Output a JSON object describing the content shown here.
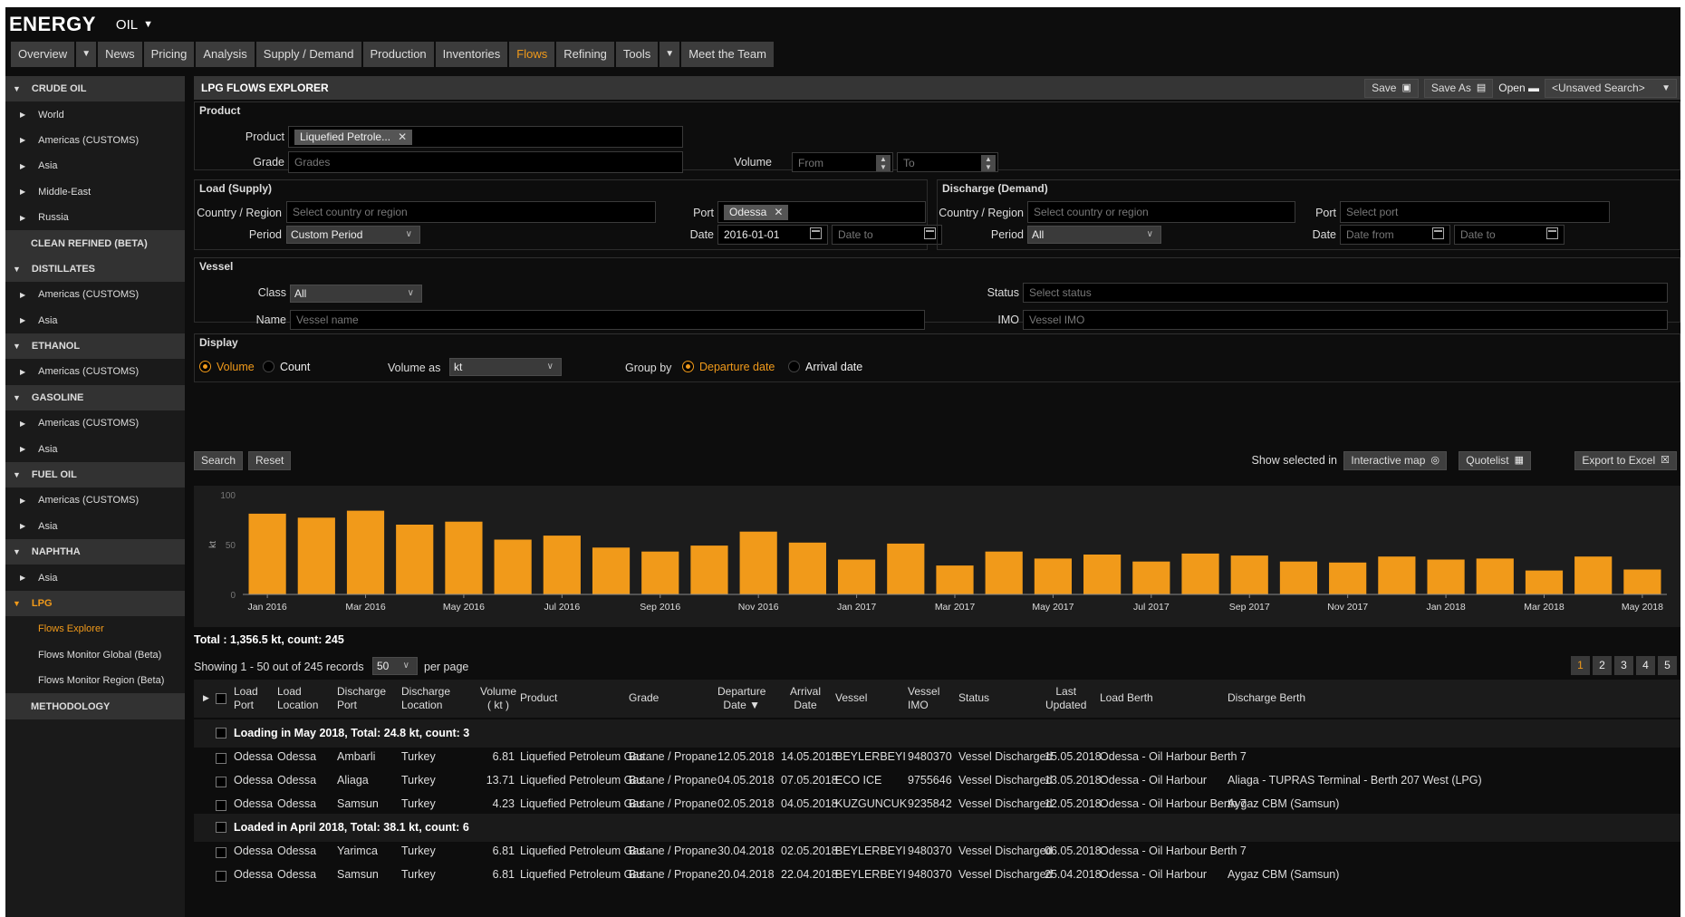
{
  "header": {
    "logo": "ENERGY",
    "commodity": "OIL"
  },
  "nav": {
    "tabs": [
      {
        "label": "Overview"
      },
      {
        "label": "▼",
        "drop": true
      },
      {
        "label": "News"
      },
      {
        "label": "Pricing"
      },
      {
        "label": "Analysis"
      },
      {
        "label": "Supply / Demand"
      },
      {
        "label": "Production"
      },
      {
        "label": "Inventories"
      },
      {
        "label": "Flows",
        "active": true
      },
      {
        "label": "Refining"
      },
      {
        "label": "Tools"
      },
      {
        "label": "▼",
        "drop": true
      },
      {
        "label": "Meet the Team"
      }
    ]
  },
  "sidebar": {
    "rows": [
      {
        "type": "section",
        "label": "CRUDE OIL"
      },
      {
        "type": "item",
        "label": "World"
      },
      {
        "type": "item",
        "label": "Americas (CUSTOMS)"
      },
      {
        "type": "item",
        "label": "Asia"
      },
      {
        "type": "item",
        "label": "Middle-East"
      },
      {
        "type": "item",
        "label": "Russia"
      },
      {
        "type": "section-noarr",
        "label": "CLEAN REFINED (BETA)"
      },
      {
        "type": "section",
        "label": "DISTILLATES"
      },
      {
        "type": "item",
        "label": "Americas (CUSTOMS)"
      },
      {
        "type": "item",
        "label": "Asia"
      },
      {
        "type": "section",
        "label": "ETHANOL"
      },
      {
        "type": "item",
        "label": "Americas (CUSTOMS)"
      },
      {
        "type": "section",
        "label": "GASOLINE"
      },
      {
        "type": "item",
        "label": "Americas (CUSTOMS)"
      },
      {
        "type": "item",
        "label": "Asia"
      },
      {
        "type": "section",
        "label": "FUEL OIL"
      },
      {
        "type": "item",
        "label": "Americas (CUSTOMS)"
      },
      {
        "type": "item",
        "label": "Asia"
      },
      {
        "type": "section",
        "label": "NAPHTHA"
      },
      {
        "type": "item",
        "label": "Asia"
      },
      {
        "type": "section-active",
        "label": "LPG"
      },
      {
        "type": "sub-active",
        "label": "Flows Explorer"
      },
      {
        "type": "sub",
        "label": "Flows Monitor Global (Beta)"
      },
      {
        "type": "sub",
        "label": "Flows Monitor Region (Beta)"
      },
      {
        "type": "section-noarr",
        "label": "METHODOLOGY"
      }
    ]
  },
  "panel": {
    "title": "LPG FLOWS EXPLORER",
    "save": "Save",
    "save_as": "Save As",
    "open": "Open",
    "search_select": "<Unsaved Search>"
  },
  "product": {
    "heading": "Product",
    "product_label": "Product",
    "product_tag": "Liquefied Petrole...",
    "grade_label": "Grade",
    "grade_placeholder": "Grades",
    "volume_label": "Volume",
    "volume_from": "From",
    "volume_to": "To"
  },
  "load": {
    "heading": "Load (Supply)",
    "country_label": "Country / Region",
    "country_placeholder": "Select country or region",
    "port_label": "Port",
    "port_tag": "Odessa",
    "period_label": "Period",
    "period_value": "Custom Period",
    "date_label": "Date",
    "date_from": "2016-01-01",
    "date_to": "Date to"
  },
  "discharge": {
    "heading": "Discharge (Demand)",
    "country_label": "Country / Region",
    "country_placeholder": "Select country or region",
    "port_label": "Port",
    "port_placeholder": "Select port",
    "period_label": "Period",
    "period_value": "All",
    "date_label": "Date",
    "date_from": "Date from",
    "date_to": "Date to"
  },
  "vessel": {
    "heading": "Vessel",
    "class_label": "Class",
    "class_value": "All",
    "name_label": "Name",
    "name_placeholder": "Vessel name",
    "status_label": "Status",
    "status_placeholder": "Select status",
    "imo_label": "IMO",
    "imo_placeholder": "Vessel IMO"
  },
  "display": {
    "heading": "Display",
    "volume": "Volume",
    "count": "Count",
    "volume_as_label": "Volume as",
    "volume_as_value": "kt",
    "group_by_label": "Group by",
    "departure": "Departure date",
    "arrival": "Arrival date"
  },
  "actions": {
    "search": "Search",
    "reset": "Reset",
    "show_selected": "Show selected in",
    "interactive_map": "Interactive map",
    "quotelist": "Quotelist",
    "export": "Export to Excel"
  },
  "chart_data": {
    "type": "bar",
    "ylabel": "kt",
    "ylim": [
      0,
      100
    ],
    "yticks": [
      0,
      50,
      100
    ],
    "color": "#f19a1a",
    "x_tick_labels": [
      "Jan 2016",
      "Mar 2016",
      "May 2016",
      "Jul 2016",
      "Sep 2016",
      "Nov 2016",
      "Jan 2017",
      "Mar 2017",
      "May 2017",
      "Jul 2017",
      "Sep 2017",
      "Nov 2017",
      "Jan 2018",
      "Mar 2018",
      "May 2018"
    ],
    "categories": [
      "Jan 2016",
      "Feb 2016",
      "Mar 2016",
      "Apr 2016",
      "May 2016",
      "Jun 2016",
      "Jul 2016",
      "Aug 2016",
      "Sep 2016",
      "Oct 2016",
      "Nov 2016",
      "Dec 2016",
      "Jan 2017",
      "Feb 2017",
      "Mar 2017",
      "Apr 2017",
      "May 2017",
      "Jun 2017",
      "Jul 2017",
      "Aug 2017",
      "Sep 2017",
      "Oct 2017",
      "Nov 2017",
      "Dec 2017",
      "Jan 2018",
      "Feb 2018",
      "Mar 2018",
      "Apr 2018",
      "May 2018"
    ],
    "values": [
      81,
      77,
      84,
      70,
      73,
      55,
      59,
      47,
      43,
      49,
      63,
      52,
      35,
      51,
      29,
      43,
      36,
      40,
      33,
      41,
      39,
      33,
      32,
      38,
      35,
      36,
      24,
      38,
      25
    ]
  },
  "summary": {
    "total": "Total : 1,356.5 kt, count: 245",
    "showing": "Showing 1 - 50 out of 245 records",
    "per_page_value": "50",
    "per_page": "per page",
    "pages": [
      "1",
      "2",
      "3",
      "4",
      "5"
    ]
  },
  "table": {
    "headers": {
      "load_port": "Load\nPort",
      "load_location": "Load\nLocation",
      "discharge_port": "Discharge\nPort",
      "discharge_location": "Discharge\nLocation",
      "volume": "Volume\n( kt )",
      "product": "Product",
      "grade": "Grade",
      "departure": "Departure\nDate ▼",
      "arrival": "Arrival\nDate",
      "vessel": "Vessel",
      "imo": "Vessel\nIMO",
      "status": "Status",
      "last_updated": "Last\nUpdated",
      "load_berth": "Load Berth",
      "discharge_berth": "Discharge Berth"
    },
    "rows": [
      {
        "group": "Loading in May 2018, Total: 24.8 kt, count: 3"
      },
      {
        "load_port": "Odessa",
        "load_location": "Odessa",
        "discharge_port": "Ambarli",
        "discharge_location": "Turkey",
        "volume": "6.81",
        "product": "Liquefied Petroleum Gas",
        "grade": "Butane / Propane",
        "departure": "12.05.2018",
        "arrival": "14.05.2018",
        "vessel": "BEYLERBEYI",
        "imo": "9480370",
        "status": "Vessel Discharged",
        "last_updated": "15.05.2018",
        "load_berth": "Odessa - Oil Harbour Berth 7",
        "discharge_berth": ""
      },
      {
        "load_port": "Odessa",
        "load_location": "Odessa",
        "discharge_port": "Aliaga",
        "discharge_location": "Turkey",
        "volume": "13.71",
        "product": "Liquefied Petroleum Gas",
        "grade": "Butane / Propane",
        "departure": "04.05.2018",
        "arrival": "07.05.2018",
        "vessel": "ECO ICE",
        "imo": "9755646",
        "status": "Vessel Discharged",
        "last_updated": "13.05.2018",
        "load_berth": "Odessa - Oil Harbour",
        "discharge_berth": "Aliaga - TUPRAS Terminal - Berth 207 West (LPG)"
      },
      {
        "load_port": "Odessa",
        "load_location": "Odessa",
        "discharge_port": "Samsun",
        "discharge_location": "Turkey",
        "volume": "4.23",
        "product": "Liquefied Petroleum Gas",
        "grade": "Butane / Propane",
        "departure": "02.05.2018",
        "arrival": "04.05.2018",
        "vessel": "KUZGUNCUK",
        "imo": "9235842",
        "status": "Vessel Discharged",
        "last_updated": "12.05.2018",
        "load_berth": "Odessa - Oil Harbour Berth 7",
        "discharge_berth": "Aygaz CBM (Samsun)"
      },
      {
        "group": "Loaded in April 2018, Total: 38.1 kt, count: 6"
      },
      {
        "load_port": "Odessa",
        "load_location": "Odessa",
        "discharge_port": "Yarimca",
        "discharge_location": "Turkey",
        "volume": "6.81",
        "product": "Liquefied Petroleum Gas",
        "grade": "Butane / Propane",
        "departure": "30.04.2018",
        "arrival": "02.05.2018",
        "vessel": "BEYLERBEYI",
        "imo": "9480370",
        "status": "Vessel Discharged",
        "last_updated": "06.05.2018",
        "load_berth": "Odessa - Oil Harbour Berth 7",
        "discharge_berth": ""
      },
      {
        "load_port": "Odessa",
        "load_location": "Odessa",
        "discharge_port": "Samsun",
        "discharge_location": "Turkey",
        "volume": "6.81",
        "product": "Liquefied Petroleum Gas",
        "grade": "Butane / Propane",
        "departure": "20.04.2018",
        "arrival": "22.04.2018",
        "vessel": "BEYLERBEYI",
        "imo": "9480370",
        "status": "Vessel Discharged",
        "last_updated": "25.04.2018",
        "load_berth": "Odessa - Oil Harbour",
        "discharge_berth": "Aygaz CBM (Samsun)"
      }
    ]
  }
}
